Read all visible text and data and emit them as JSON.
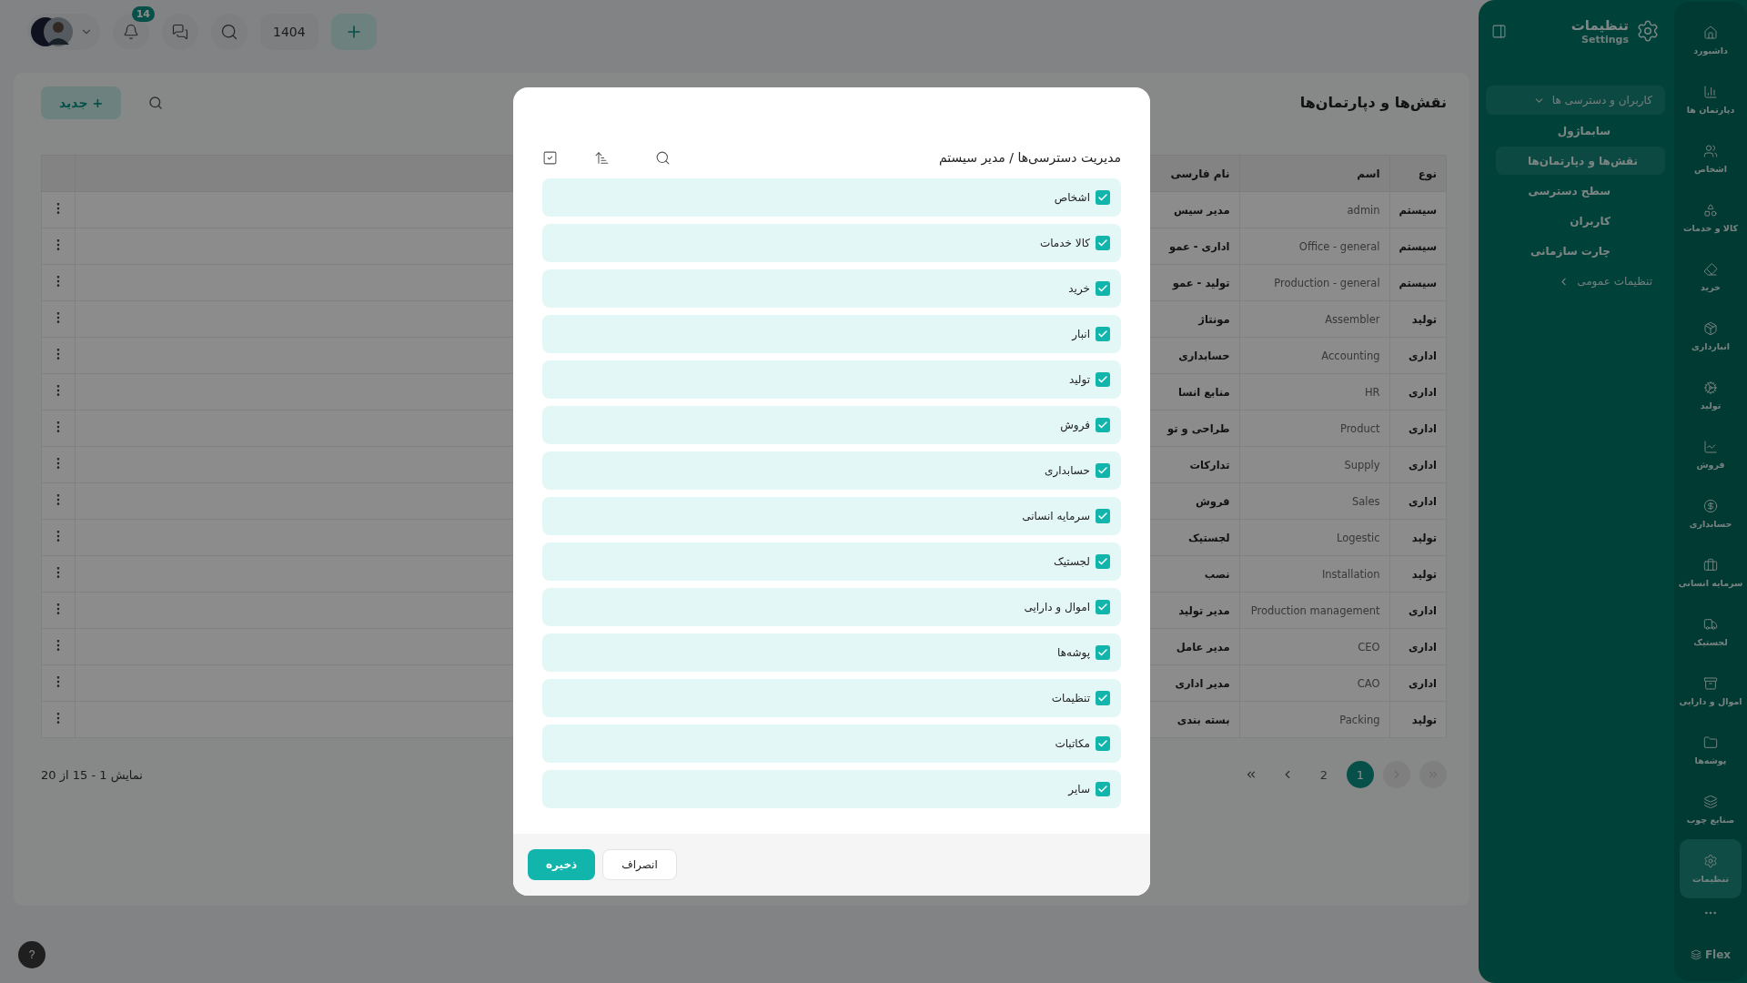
{
  "topbar": {
    "notifications": "14",
    "year": "1404"
  },
  "page": {
    "title": "نقش‌ها و دپارتمان‌ها",
    "new_button": "+ جدید"
  },
  "table": {
    "columns": [
      "نوع",
      "اسم",
      "نام فارسی"
    ],
    "rows": [
      {
        "type": "سیستم",
        "name": "admin",
        "fa": "مدیر سیس"
      },
      {
        "type": "سیستم",
        "name": "Office - general",
        "fa": "اداری - عمو"
      },
      {
        "type": "سیستم",
        "name": "Production - general",
        "fa": "تولید - عمو"
      },
      {
        "type": "تولید",
        "name": "Assembler",
        "fa": "مونتاژ"
      },
      {
        "type": "اداری",
        "name": "Accounting",
        "fa": "حسابداری"
      },
      {
        "type": "اداری",
        "name": "HR",
        "fa": "منابع انسا"
      },
      {
        "type": "اداری",
        "name": "Product",
        "fa": "طراحی و تو"
      },
      {
        "type": "اداری",
        "name": "Supply",
        "fa": "تدارکات"
      },
      {
        "type": "اداری",
        "name": "Sales",
        "fa": "فروش"
      },
      {
        "type": "تولید",
        "name": "Logestic",
        "fa": "لجستیک"
      },
      {
        "type": "تولید",
        "name": "Installation",
        "fa": "نصب"
      },
      {
        "type": "اداری",
        "name": "Production management",
        "fa": "مدیر تولید"
      },
      {
        "type": "اداری",
        "name": "CEO",
        "fa": "مدیر عامل"
      },
      {
        "type": "اداری",
        "name": "CAO",
        "fa": "مدیر اداری"
      },
      {
        "type": "تولید",
        "name": "Packing",
        "fa": "بسته بندی"
      }
    ]
  },
  "summary": "نمایش 1 - 15 از 20",
  "pagination": {
    "first_disabled": true,
    "prev_disabled": true,
    "next_disabled": false,
    "last_disabled": false,
    "pages": [
      {
        "label": "1",
        "selected": true
      },
      {
        "label": "2",
        "selected": false
      }
    ]
  },
  "settings_panel": {
    "title": "تنظیمات",
    "subtitle": "Settings",
    "menu": [
      {
        "label": "کاربران و دسترسی ها",
        "expanded": true,
        "children": [
          {
            "label": "سابماژول",
            "selected": false
          },
          {
            "label": "نقش‌ها و دپارتمان‌ها",
            "selected": true
          },
          {
            "label": "سطح دسترسی",
            "selected": false
          },
          {
            "label": "کاربران",
            "selected": false
          },
          {
            "label": "چارت سازمانی",
            "selected": false
          }
        ]
      },
      {
        "label": "تنظیمات عمومی",
        "expanded": false
      }
    ]
  },
  "rail": {
    "items": [
      {
        "label": "داشبورد",
        "selected": false
      },
      {
        "label": "دپارتمان ها",
        "selected": false
      },
      {
        "label": "اشخاص",
        "selected": false
      },
      {
        "label": "کالا و خدمات",
        "selected": false
      },
      {
        "label": "خرید",
        "selected": false
      },
      {
        "label": "انبارداری",
        "selected": false
      },
      {
        "label": "تولید",
        "selected": false
      },
      {
        "label": "فروش",
        "selected": false
      },
      {
        "label": "حسابداری",
        "selected": false
      },
      {
        "label": "سرمایه انسانی",
        "selected": false
      },
      {
        "label": "لجستیک",
        "selected": false
      },
      {
        "label": "اموال و دارایی",
        "selected": false
      },
      {
        "label": "پوشه‌ها",
        "selected": false
      },
      {
        "label": "صنایع چوب",
        "selected": false
      },
      {
        "label": "تنظیمات",
        "selected": true
      }
    ],
    "brand": "Flex"
  },
  "help": "?",
  "modal": {
    "title": "مدیریت دسترسی‌ها / مدیر سیستم",
    "items": [
      {
        "label": "اشخاص",
        "checked": true
      },
      {
        "label": "کالا خدمات",
        "checked": true
      },
      {
        "label": "خرید",
        "checked": true
      },
      {
        "label": "انبار",
        "checked": true
      },
      {
        "label": "تولید",
        "checked": true
      },
      {
        "label": "فروش",
        "checked": true
      },
      {
        "label": "حسابداری",
        "checked": true
      },
      {
        "label": "سرمایه انسانی",
        "checked": true
      },
      {
        "label": "لجستیک",
        "checked": true
      },
      {
        "label": "اموال و دارایی",
        "checked": true
      },
      {
        "label": "پوشه‌ها",
        "checked": true
      },
      {
        "label": "تنظیمات",
        "checked": true
      },
      {
        "label": "مکاتبات",
        "checked": true
      },
      {
        "label": "سایر",
        "checked": true
      }
    ],
    "save": "ذخیره",
    "cancel": "انصراف"
  }
}
